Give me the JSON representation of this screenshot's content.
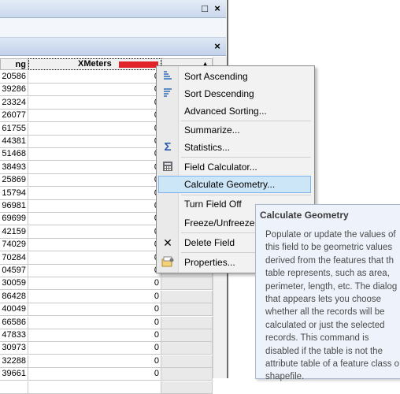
{
  "window": {
    "buttons": {
      "restore": "□",
      "close": "×"
    }
  },
  "inner_panel": {
    "buttons": {
      "close": "×"
    }
  },
  "table": {
    "columns": [
      {
        "label": "ng"
      },
      {
        "label": "XMeters"
      },
      {
        "label": "▲"
      }
    ],
    "rows": [
      {
        "a": "20586",
        "b": "0"
      },
      {
        "a": "39286",
        "b": "0"
      },
      {
        "a": "23324",
        "b": "0"
      },
      {
        "a": "26077",
        "b": "0"
      },
      {
        "a": "61755",
        "b": "0"
      },
      {
        "a": "44381",
        "b": "0"
      },
      {
        "a": "51468",
        "b": "0"
      },
      {
        "a": "38493",
        "b": "0"
      },
      {
        "a": "25869",
        "b": "0"
      },
      {
        "a": "15794",
        "b": "0"
      },
      {
        "a": "96981",
        "b": "0"
      },
      {
        "a": "69699",
        "b": "0"
      },
      {
        "a": "42159",
        "b": "0"
      },
      {
        "a": "74029",
        "b": "0"
      },
      {
        "a": "70284",
        "b": "0"
      },
      {
        "a": "04597",
        "b": "0"
      },
      {
        "a": "30059",
        "b": "0"
      },
      {
        "a": "86428",
        "b": "0"
      },
      {
        "a": "40049",
        "b": "0"
      },
      {
        "a": "66586",
        "b": "0"
      },
      {
        "a": "47833",
        "b": "0"
      },
      {
        "a": "30973",
        "b": "0"
      },
      {
        "a": "32288",
        "b": "0"
      },
      {
        "a": "39661",
        "b": "0"
      },
      {
        "a": "",
        "b": ""
      }
    ]
  },
  "context_menu": {
    "items": [
      {
        "label": "Sort Ascending",
        "icon": "sort-ascending-icon"
      },
      {
        "label": "Sort Descending",
        "icon": "sort-descending-icon"
      },
      {
        "label": "Advanced Sorting...",
        "icon": ""
      },
      {
        "label": "Summarize...",
        "icon": ""
      },
      {
        "label": "Statistics...",
        "icon": "sigma-icon"
      },
      {
        "label": "Field Calculator...",
        "icon": "calculator-icon"
      },
      {
        "label": "Calculate Geometry...",
        "icon": "",
        "highlighted": true
      },
      {
        "label": "Turn Field Off",
        "icon": ""
      },
      {
        "label": "Freeze/Unfreeze C",
        "icon": ""
      },
      {
        "label": "Delete Field",
        "icon": "delete-x-icon"
      },
      {
        "label": "Properties...",
        "icon": "properties-icon"
      }
    ]
  },
  "tooltip": {
    "title": "Calculate Geometry",
    "lines": [
      "Populate or update the values of",
      "this field to be geometric values",
      "derived from the features that th",
      "table represents, such as area,",
      "perimeter, length, etc. The dialog",
      "that appears lets you choose",
      "whether all the records will be",
      "calculated or just the selected",
      "records. This command is",
      "disabled if the table is not the",
      "attribute table of a feature class o",
      "shapefile."
    ]
  },
  "colors": {
    "accent_red": "#e1232a",
    "menu_highlight": "#cde6f7",
    "tooltip_bg": "#eef3fb"
  }
}
